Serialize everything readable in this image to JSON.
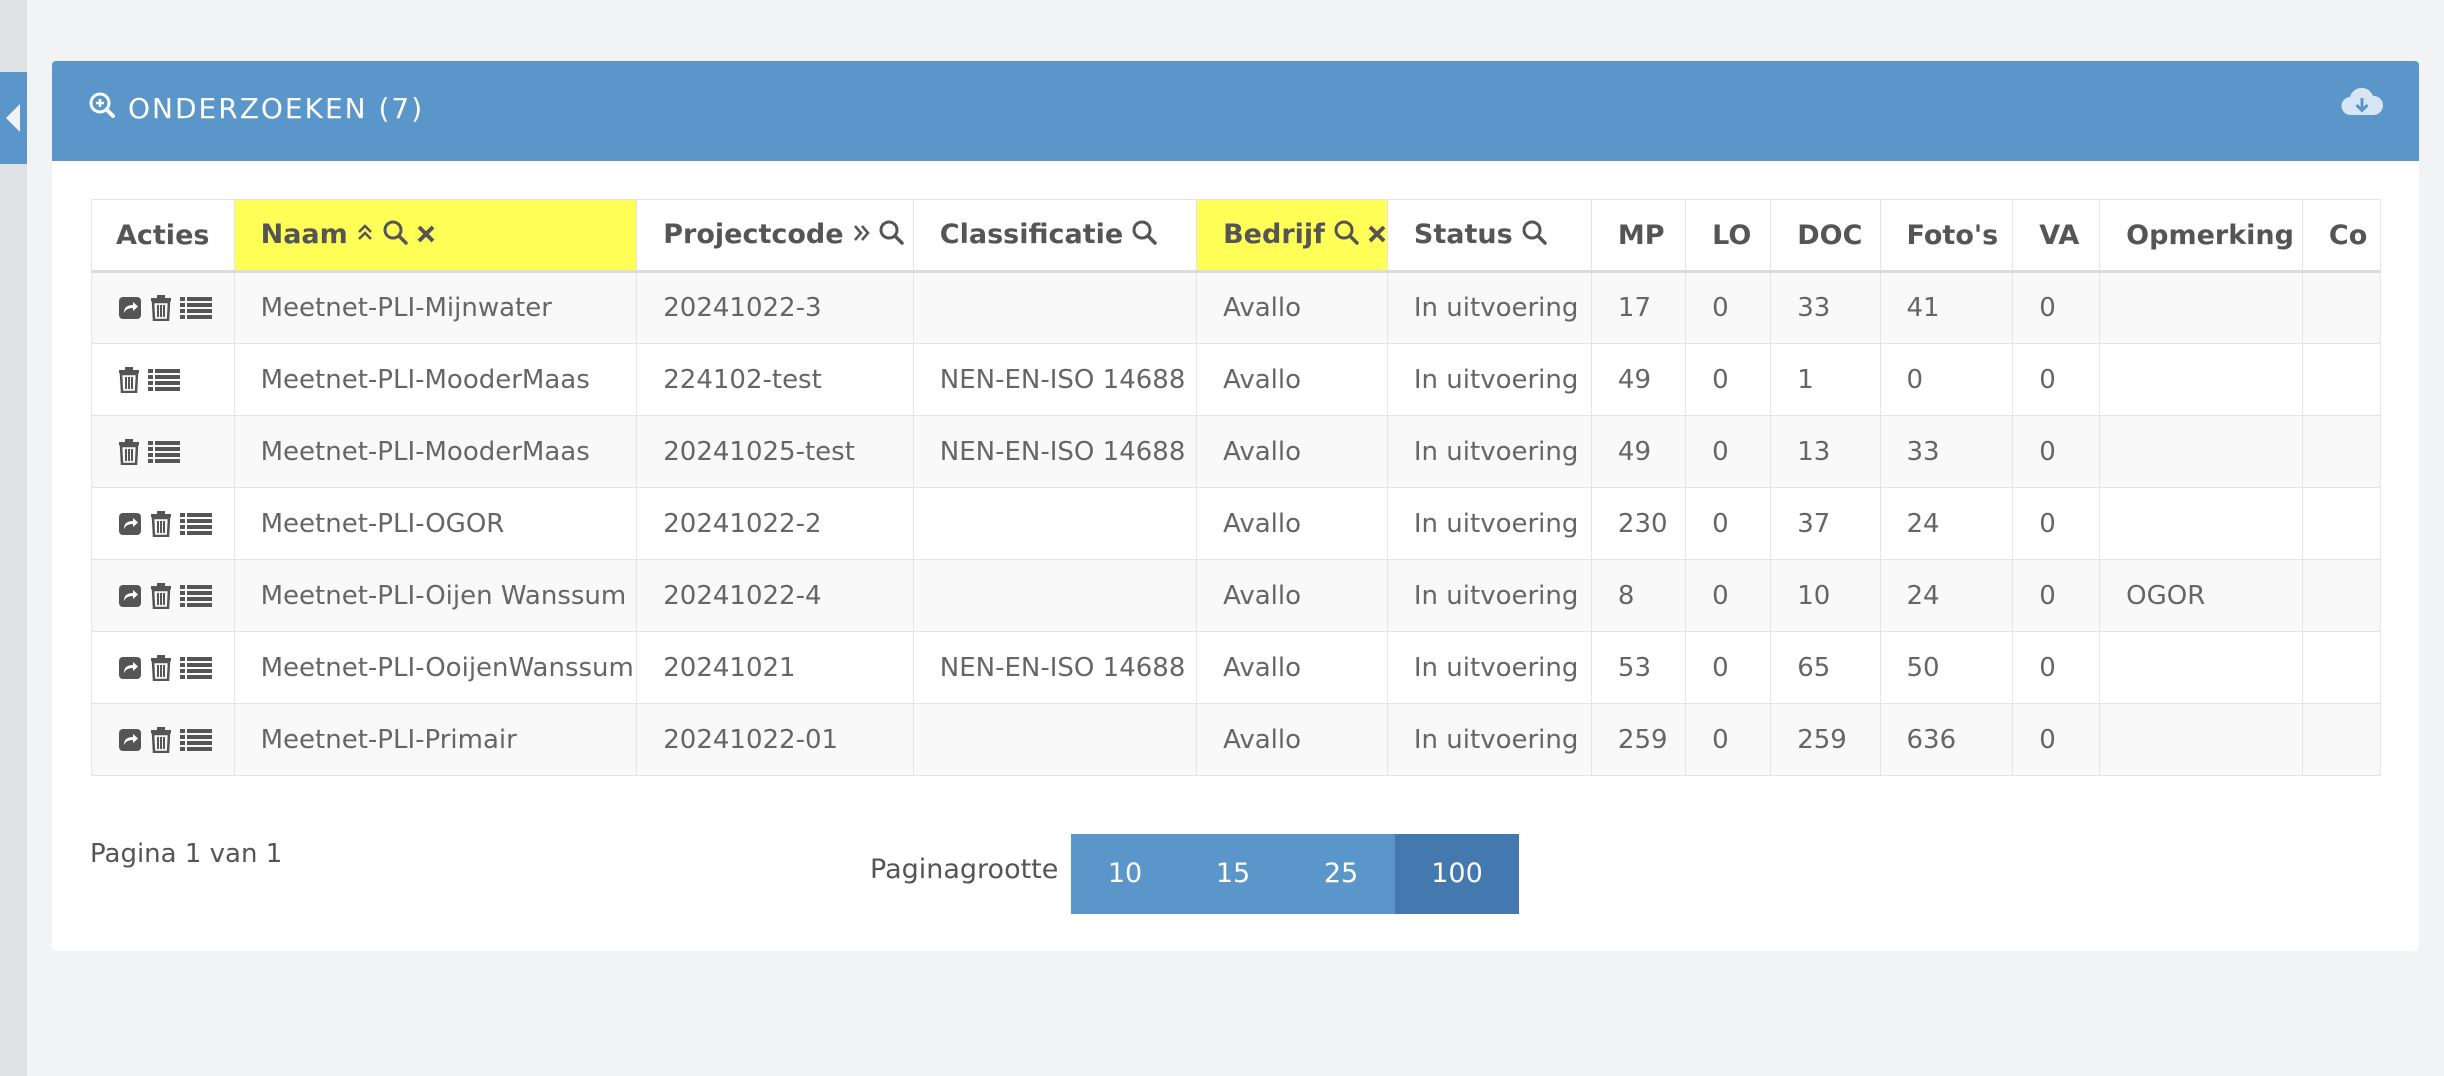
{
  "header": {
    "title": "ONDERZOEKEN (7)"
  },
  "table": {
    "columns": [
      "Acties",
      "Naam",
      "Projectcode",
      "Classificatie",
      "Bedrijf",
      "Status",
      "MP",
      "LO",
      "DOC",
      "Foto's",
      "VA",
      "Opmerking",
      "Co"
    ],
    "rows": [
      {
        "actions": [
          "share",
          "delete",
          "list"
        ],
        "naam": "Meetnet-PLI-Mijnwater",
        "projectcode": "20241022-3",
        "classificatie": "",
        "bedrijf": "Avallo",
        "status": "In uitvoering",
        "mp": "17",
        "lo": "0",
        "doc": "33",
        "fotos": "41",
        "va": "0",
        "opmerking": ""
      },
      {
        "actions": [
          "delete",
          "list"
        ],
        "naam": "Meetnet-PLI-MooderMaas",
        "projectcode": "224102-test",
        "classificatie": "NEN-EN-ISO 14688",
        "bedrijf": "Avallo",
        "status": "In uitvoering",
        "mp": "49",
        "lo": "0",
        "doc": "1",
        "fotos": "0",
        "va": "0",
        "opmerking": ""
      },
      {
        "actions": [
          "delete",
          "list"
        ],
        "naam": "Meetnet-PLI-MooderMaas",
        "projectcode": "20241025-test",
        "classificatie": "NEN-EN-ISO 14688",
        "bedrijf": "Avallo",
        "status": "In uitvoering",
        "mp": "49",
        "lo": "0",
        "doc": "13",
        "fotos": "33",
        "va": "0",
        "opmerking": ""
      },
      {
        "actions": [
          "share",
          "delete",
          "list"
        ],
        "naam": "Meetnet-PLI-OGOR",
        "projectcode": "20241022-2",
        "classificatie": "",
        "bedrijf": "Avallo",
        "status": "In uitvoering",
        "mp": "230",
        "lo": "0",
        "doc": "37",
        "fotos": "24",
        "va": "0",
        "opmerking": ""
      },
      {
        "actions": [
          "share",
          "delete",
          "list"
        ],
        "naam": "Meetnet-PLI-Oijen Wanssum",
        "projectcode": "20241022-4",
        "classificatie": "",
        "bedrijf": "Avallo",
        "status": "In uitvoering",
        "mp": "8",
        "lo": "0",
        "doc": "10",
        "fotos": "24",
        "va": "0",
        "opmerking": "OGOR"
      },
      {
        "actions": [
          "share",
          "delete",
          "list"
        ],
        "naam": "Meetnet-PLI-OoijenWanssum",
        "projectcode": "20241021",
        "classificatie": "NEN-EN-ISO 14688",
        "bedrijf": "Avallo",
        "status": "In uitvoering",
        "mp": "53",
        "lo": "0",
        "doc": "65",
        "fotos": "50",
        "va": "0",
        "opmerking": ""
      },
      {
        "actions": [
          "share",
          "delete",
          "list"
        ],
        "naam": "Meetnet-PLI-Primair",
        "projectcode": "20241022-01",
        "classificatie": "",
        "bedrijf": "Avallo",
        "status": "In uitvoering",
        "mp": "259",
        "lo": "0",
        "doc": "259",
        "fotos": "636",
        "va": "0",
        "opmerking": ""
      }
    ]
  },
  "pager": {
    "info": "Pagina 1 van 1",
    "pagesize_label": "Paginagrootte",
    "options": [
      "10",
      "15",
      "25",
      "100"
    ],
    "active": "100"
  },
  "colors": {
    "accent": "#5a96c9",
    "accent_active": "#4479b0",
    "highlight": "#ffff57"
  }
}
